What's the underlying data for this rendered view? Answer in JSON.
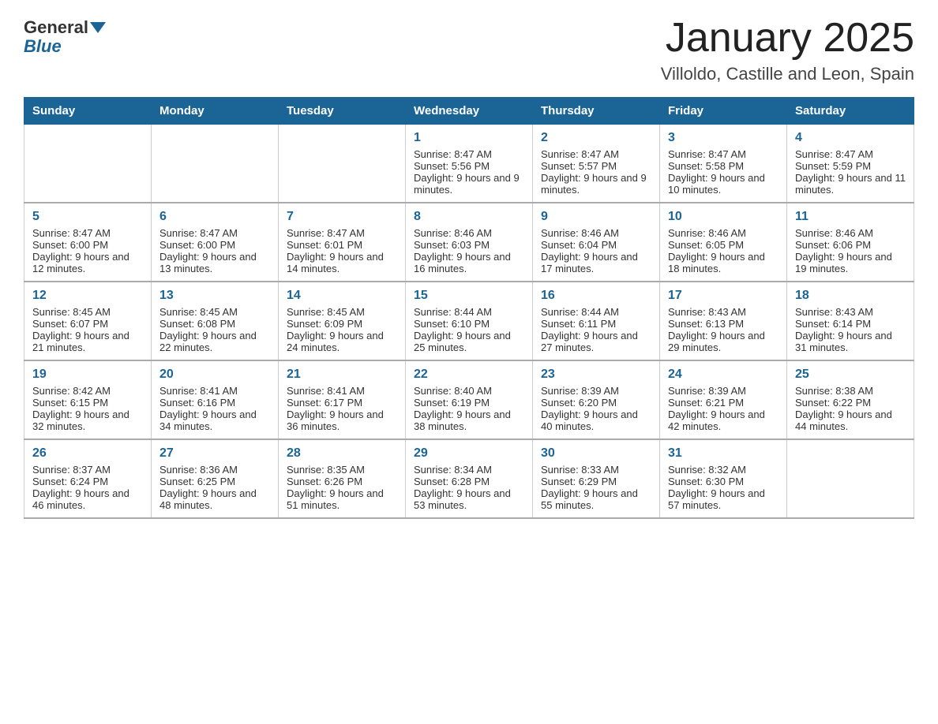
{
  "header": {
    "logo_general": "General",
    "logo_blue": "Blue",
    "month_title": "January 2025",
    "location": "Villoldo, Castille and Leon, Spain"
  },
  "weekdays": [
    "Sunday",
    "Monday",
    "Tuesday",
    "Wednesday",
    "Thursday",
    "Friday",
    "Saturday"
  ],
  "weeks": [
    [
      {
        "day": "",
        "info": ""
      },
      {
        "day": "",
        "info": ""
      },
      {
        "day": "",
        "info": ""
      },
      {
        "day": "1",
        "info": "Sunrise: 8:47 AM\nSunset: 5:56 PM\nDaylight: 9 hours and 9 minutes."
      },
      {
        "day": "2",
        "info": "Sunrise: 8:47 AM\nSunset: 5:57 PM\nDaylight: 9 hours and 9 minutes."
      },
      {
        "day": "3",
        "info": "Sunrise: 8:47 AM\nSunset: 5:58 PM\nDaylight: 9 hours and 10 minutes."
      },
      {
        "day": "4",
        "info": "Sunrise: 8:47 AM\nSunset: 5:59 PM\nDaylight: 9 hours and 11 minutes."
      }
    ],
    [
      {
        "day": "5",
        "info": "Sunrise: 8:47 AM\nSunset: 6:00 PM\nDaylight: 9 hours and 12 minutes."
      },
      {
        "day": "6",
        "info": "Sunrise: 8:47 AM\nSunset: 6:00 PM\nDaylight: 9 hours and 13 minutes."
      },
      {
        "day": "7",
        "info": "Sunrise: 8:47 AM\nSunset: 6:01 PM\nDaylight: 9 hours and 14 minutes."
      },
      {
        "day": "8",
        "info": "Sunrise: 8:46 AM\nSunset: 6:03 PM\nDaylight: 9 hours and 16 minutes."
      },
      {
        "day": "9",
        "info": "Sunrise: 8:46 AM\nSunset: 6:04 PM\nDaylight: 9 hours and 17 minutes."
      },
      {
        "day": "10",
        "info": "Sunrise: 8:46 AM\nSunset: 6:05 PM\nDaylight: 9 hours and 18 minutes."
      },
      {
        "day": "11",
        "info": "Sunrise: 8:46 AM\nSunset: 6:06 PM\nDaylight: 9 hours and 19 minutes."
      }
    ],
    [
      {
        "day": "12",
        "info": "Sunrise: 8:45 AM\nSunset: 6:07 PM\nDaylight: 9 hours and 21 minutes."
      },
      {
        "day": "13",
        "info": "Sunrise: 8:45 AM\nSunset: 6:08 PM\nDaylight: 9 hours and 22 minutes."
      },
      {
        "day": "14",
        "info": "Sunrise: 8:45 AM\nSunset: 6:09 PM\nDaylight: 9 hours and 24 minutes."
      },
      {
        "day": "15",
        "info": "Sunrise: 8:44 AM\nSunset: 6:10 PM\nDaylight: 9 hours and 25 minutes."
      },
      {
        "day": "16",
        "info": "Sunrise: 8:44 AM\nSunset: 6:11 PM\nDaylight: 9 hours and 27 minutes."
      },
      {
        "day": "17",
        "info": "Sunrise: 8:43 AM\nSunset: 6:13 PM\nDaylight: 9 hours and 29 minutes."
      },
      {
        "day": "18",
        "info": "Sunrise: 8:43 AM\nSunset: 6:14 PM\nDaylight: 9 hours and 31 minutes."
      }
    ],
    [
      {
        "day": "19",
        "info": "Sunrise: 8:42 AM\nSunset: 6:15 PM\nDaylight: 9 hours and 32 minutes."
      },
      {
        "day": "20",
        "info": "Sunrise: 8:41 AM\nSunset: 6:16 PM\nDaylight: 9 hours and 34 minutes."
      },
      {
        "day": "21",
        "info": "Sunrise: 8:41 AM\nSunset: 6:17 PM\nDaylight: 9 hours and 36 minutes."
      },
      {
        "day": "22",
        "info": "Sunrise: 8:40 AM\nSunset: 6:19 PM\nDaylight: 9 hours and 38 minutes."
      },
      {
        "day": "23",
        "info": "Sunrise: 8:39 AM\nSunset: 6:20 PM\nDaylight: 9 hours and 40 minutes."
      },
      {
        "day": "24",
        "info": "Sunrise: 8:39 AM\nSunset: 6:21 PM\nDaylight: 9 hours and 42 minutes."
      },
      {
        "day": "25",
        "info": "Sunrise: 8:38 AM\nSunset: 6:22 PM\nDaylight: 9 hours and 44 minutes."
      }
    ],
    [
      {
        "day": "26",
        "info": "Sunrise: 8:37 AM\nSunset: 6:24 PM\nDaylight: 9 hours and 46 minutes."
      },
      {
        "day": "27",
        "info": "Sunrise: 8:36 AM\nSunset: 6:25 PM\nDaylight: 9 hours and 48 minutes."
      },
      {
        "day": "28",
        "info": "Sunrise: 8:35 AM\nSunset: 6:26 PM\nDaylight: 9 hours and 51 minutes."
      },
      {
        "day": "29",
        "info": "Sunrise: 8:34 AM\nSunset: 6:28 PM\nDaylight: 9 hours and 53 minutes."
      },
      {
        "day": "30",
        "info": "Sunrise: 8:33 AM\nSunset: 6:29 PM\nDaylight: 9 hours and 55 minutes."
      },
      {
        "day": "31",
        "info": "Sunrise: 8:32 AM\nSunset: 6:30 PM\nDaylight: 9 hours and 57 minutes."
      },
      {
        "day": "",
        "info": ""
      }
    ]
  ]
}
